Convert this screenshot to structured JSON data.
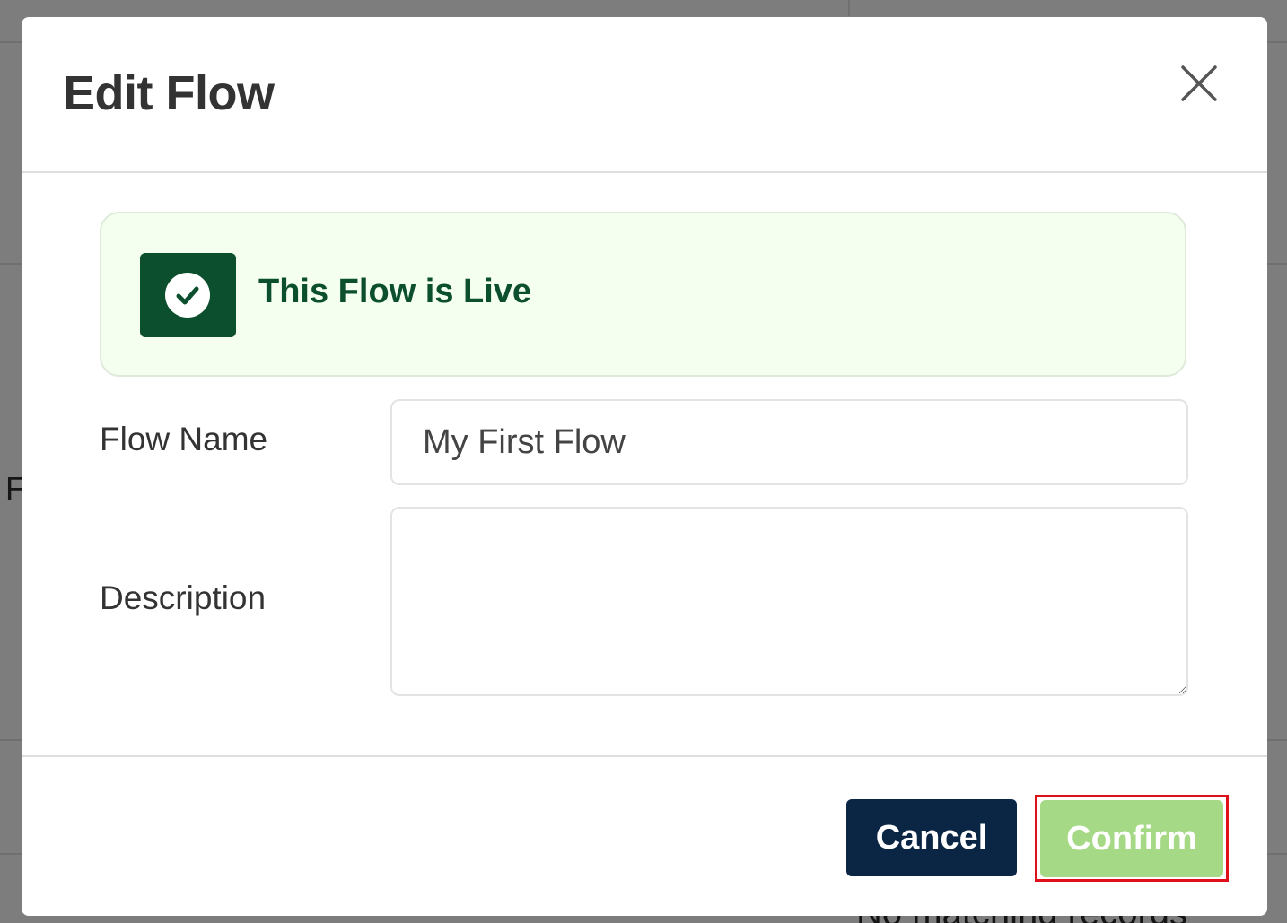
{
  "modal": {
    "title": "Edit Flow",
    "close_icon": "close-icon"
  },
  "live_banner": {
    "text": "This Flow is Live",
    "icon": "check-circle-icon",
    "colors": {
      "background": "#f5fff0",
      "accent": "#0c4f2e"
    }
  },
  "form": {
    "flow_name": {
      "label": "Flow Name",
      "value": "My First Flow"
    },
    "description": {
      "label": "Description",
      "value": ""
    }
  },
  "footer": {
    "cancel_label": "Cancel",
    "confirm_label": "Confirm",
    "colors": {
      "cancel": "#0b2545",
      "confirm": "#a5d985",
      "highlight": "#e0101a"
    }
  },
  "background": {
    "partial_letter": "F",
    "footer_text": "No matching records"
  }
}
